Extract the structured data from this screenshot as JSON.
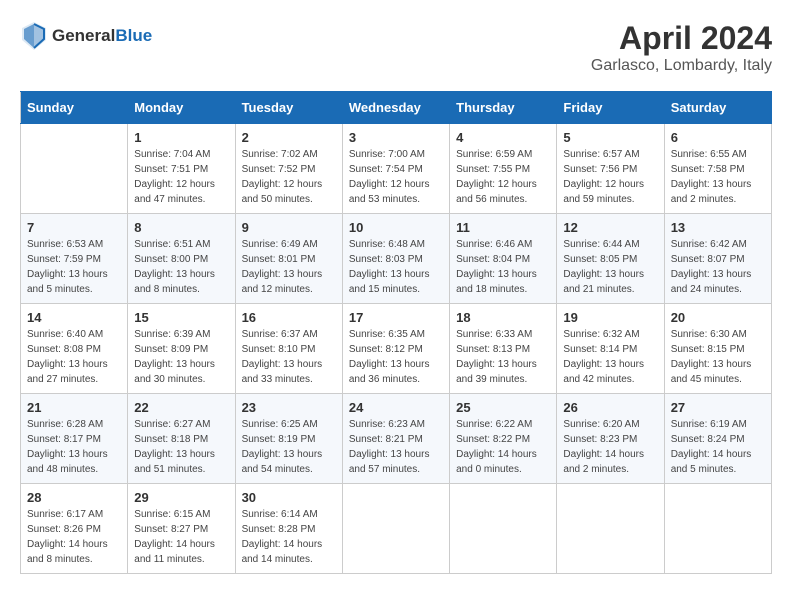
{
  "header": {
    "logo_general": "General",
    "logo_blue": "Blue",
    "month_year": "April 2024",
    "location": "Garlasco, Lombardy, Italy"
  },
  "days_of_week": [
    "Sunday",
    "Monday",
    "Tuesday",
    "Wednesday",
    "Thursday",
    "Friday",
    "Saturday"
  ],
  "weeks": [
    [
      {
        "day": "",
        "sunrise": "",
        "sunset": "",
        "daylight": "",
        "empty": true
      },
      {
        "day": "1",
        "sunrise": "Sunrise: 7:04 AM",
        "sunset": "Sunset: 7:51 PM",
        "daylight": "Daylight: 12 hours and 47 minutes."
      },
      {
        "day": "2",
        "sunrise": "Sunrise: 7:02 AM",
        "sunset": "Sunset: 7:52 PM",
        "daylight": "Daylight: 12 hours and 50 minutes."
      },
      {
        "day": "3",
        "sunrise": "Sunrise: 7:00 AM",
        "sunset": "Sunset: 7:54 PM",
        "daylight": "Daylight: 12 hours and 53 minutes."
      },
      {
        "day": "4",
        "sunrise": "Sunrise: 6:59 AM",
        "sunset": "Sunset: 7:55 PM",
        "daylight": "Daylight: 12 hours and 56 minutes."
      },
      {
        "day": "5",
        "sunrise": "Sunrise: 6:57 AM",
        "sunset": "Sunset: 7:56 PM",
        "daylight": "Daylight: 12 hours and 59 minutes."
      },
      {
        "day": "6",
        "sunrise": "Sunrise: 6:55 AM",
        "sunset": "Sunset: 7:58 PM",
        "daylight": "Daylight: 13 hours and 2 minutes."
      }
    ],
    [
      {
        "day": "7",
        "sunrise": "Sunrise: 6:53 AM",
        "sunset": "Sunset: 7:59 PM",
        "daylight": "Daylight: 13 hours and 5 minutes."
      },
      {
        "day": "8",
        "sunrise": "Sunrise: 6:51 AM",
        "sunset": "Sunset: 8:00 PM",
        "daylight": "Daylight: 13 hours and 8 minutes."
      },
      {
        "day": "9",
        "sunrise": "Sunrise: 6:49 AM",
        "sunset": "Sunset: 8:01 PM",
        "daylight": "Daylight: 13 hours and 12 minutes."
      },
      {
        "day": "10",
        "sunrise": "Sunrise: 6:48 AM",
        "sunset": "Sunset: 8:03 PM",
        "daylight": "Daylight: 13 hours and 15 minutes."
      },
      {
        "day": "11",
        "sunrise": "Sunrise: 6:46 AM",
        "sunset": "Sunset: 8:04 PM",
        "daylight": "Daylight: 13 hours and 18 minutes."
      },
      {
        "day": "12",
        "sunrise": "Sunrise: 6:44 AM",
        "sunset": "Sunset: 8:05 PM",
        "daylight": "Daylight: 13 hours and 21 minutes."
      },
      {
        "day": "13",
        "sunrise": "Sunrise: 6:42 AM",
        "sunset": "Sunset: 8:07 PM",
        "daylight": "Daylight: 13 hours and 24 minutes."
      }
    ],
    [
      {
        "day": "14",
        "sunrise": "Sunrise: 6:40 AM",
        "sunset": "Sunset: 8:08 PM",
        "daylight": "Daylight: 13 hours and 27 minutes."
      },
      {
        "day": "15",
        "sunrise": "Sunrise: 6:39 AM",
        "sunset": "Sunset: 8:09 PM",
        "daylight": "Daylight: 13 hours and 30 minutes."
      },
      {
        "day": "16",
        "sunrise": "Sunrise: 6:37 AM",
        "sunset": "Sunset: 8:10 PM",
        "daylight": "Daylight: 13 hours and 33 minutes."
      },
      {
        "day": "17",
        "sunrise": "Sunrise: 6:35 AM",
        "sunset": "Sunset: 8:12 PM",
        "daylight": "Daylight: 13 hours and 36 minutes."
      },
      {
        "day": "18",
        "sunrise": "Sunrise: 6:33 AM",
        "sunset": "Sunset: 8:13 PM",
        "daylight": "Daylight: 13 hours and 39 minutes."
      },
      {
        "day": "19",
        "sunrise": "Sunrise: 6:32 AM",
        "sunset": "Sunset: 8:14 PM",
        "daylight": "Daylight: 13 hours and 42 minutes."
      },
      {
        "day": "20",
        "sunrise": "Sunrise: 6:30 AM",
        "sunset": "Sunset: 8:15 PM",
        "daylight": "Daylight: 13 hours and 45 minutes."
      }
    ],
    [
      {
        "day": "21",
        "sunrise": "Sunrise: 6:28 AM",
        "sunset": "Sunset: 8:17 PM",
        "daylight": "Daylight: 13 hours and 48 minutes."
      },
      {
        "day": "22",
        "sunrise": "Sunrise: 6:27 AM",
        "sunset": "Sunset: 8:18 PM",
        "daylight": "Daylight: 13 hours and 51 minutes."
      },
      {
        "day": "23",
        "sunrise": "Sunrise: 6:25 AM",
        "sunset": "Sunset: 8:19 PM",
        "daylight": "Daylight: 13 hours and 54 minutes."
      },
      {
        "day": "24",
        "sunrise": "Sunrise: 6:23 AM",
        "sunset": "Sunset: 8:21 PM",
        "daylight": "Daylight: 13 hours and 57 minutes."
      },
      {
        "day": "25",
        "sunrise": "Sunrise: 6:22 AM",
        "sunset": "Sunset: 8:22 PM",
        "daylight": "Daylight: 14 hours and 0 minutes."
      },
      {
        "day": "26",
        "sunrise": "Sunrise: 6:20 AM",
        "sunset": "Sunset: 8:23 PM",
        "daylight": "Daylight: 14 hours and 2 minutes."
      },
      {
        "day": "27",
        "sunrise": "Sunrise: 6:19 AM",
        "sunset": "Sunset: 8:24 PM",
        "daylight": "Daylight: 14 hours and 5 minutes."
      }
    ],
    [
      {
        "day": "28",
        "sunrise": "Sunrise: 6:17 AM",
        "sunset": "Sunset: 8:26 PM",
        "daylight": "Daylight: 14 hours and 8 minutes."
      },
      {
        "day": "29",
        "sunrise": "Sunrise: 6:15 AM",
        "sunset": "Sunset: 8:27 PM",
        "daylight": "Daylight: 14 hours and 11 minutes."
      },
      {
        "day": "30",
        "sunrise": "Sunrise: 6:14 AM",
        "sunset": "Sunset: 8:28 PM",
        "daylight": "Daylight: 14 hours and 14 minutes."
      },
      {
        "day": "",
        "sunrise": "",
        "sunset": "",
        "daylight": "",
        "empty": true
      },
      {
        "day": "",
        "sunrise": "",
        "sunset": "",
        "daylight": "",
        "empty": true
      },
      {
        "day": "",
        "sunrise": "",
        "sunset": "",
        "daylight": "",
        "empty": true
      },
      {
        "day": "",
        "sunrise": "",
        "sunset": "",
        "daylight": "",
        "empty": true
      }
    ]
  ]
}
